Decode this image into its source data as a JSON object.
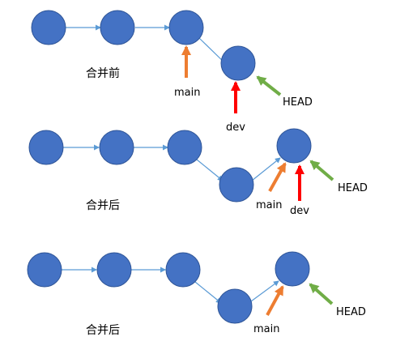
{
  "colors": {
    "node_fill": "#4472c4",
    "node_stroke": "#2f5597",
    "edge": "#5b9bd5",
    "main_pointer": "#ed7d31",
    "dev_pointer": "#ff0000",
    "head_pointer": "#70ad47",
    "text": "#000000"
  },
  "panels": [
    {
      "id": "before-merge",
      "caption": "合并前",
      "labels": {
        "main": "main",
        "dev": "dev",
        "head": "HEAD"
      }
    },
    {
      "id": "after-merge-1",
      "caption": "合并后",
      "labels": {
        "main": "main",
        "dev": "dev",
        "head": "HEAD"
      }
    },
    {
      "id": "after-merge-2",
      "caption": "合并后",
      "labels": {
        "main": "main",
        "head": "HEAD"
      }
    }
  ]
}
